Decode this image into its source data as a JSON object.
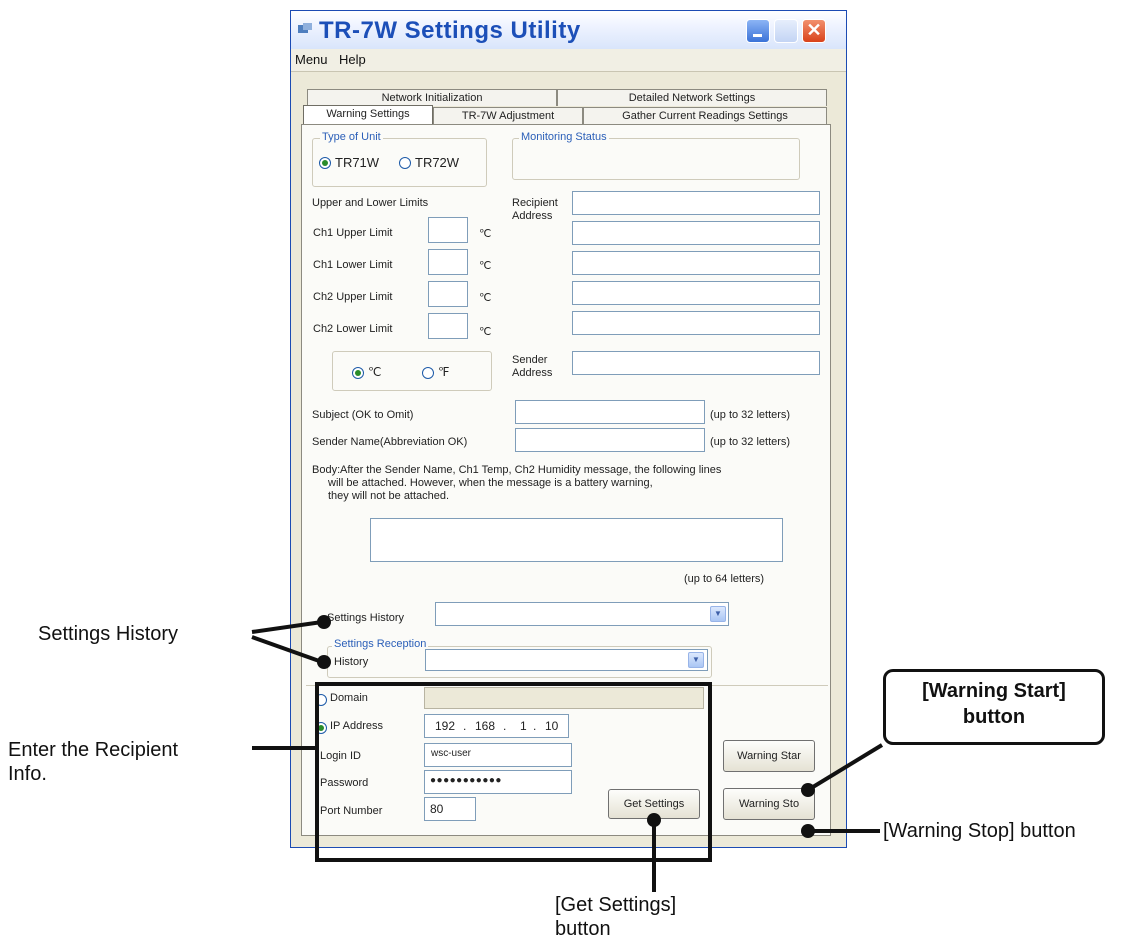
{
  "window": {
    "title": "TR-7W Settings Utility",
    "menu": [
      "Menu",
      "Help"
    ],
    "close_glyph": "✕"
  },
  "tabs": {
    "row1": [
      "Network Initialization",
      "Detailed Network Settings"
    ],
    "row2": [
      "Warning Settings",
      "TR-7W Adjustment",
      "Gather Current Readings Settings"
    ]
  },
  "unit_type": {
    "legend": "Type of Unit",
    "options": [
      "TR71W",
      "TR72W"
    ],
    "selected": "TR71W"
  },
  "monitoring_status": {
    "legend": "Monitoring Status"
  },
  "limits": {
    "heading": "Upper and Lower Limits",
    "rows": [
      {
        "label": "Ch1 Upper Limit",
        "unit": "℃"
      },
      {
        "label": "Ch1 Lower Limit",
        "unit": "℃"
      },
      {
        "label": "Ch2 Upper Limit",
        "unit": "℃"
      },
      {
        "label": "Ch2 Lower Limit",
        "unit": "℃"
      }
    ],
    "temp_units": [
      "℃",
      "℉"
    ],
    "temp_unit_selected": "℃"
  },
  "recipient": {
    "label_line1": "Recipient",
    "label_line2": "Address"
  },
  "sender": {
    "label_line1": "Sender",
    "label_line2": "Address"
  },
  "subject": {
    "label": "Subject (OK to Omit)",
    "hint": "(up to 32 letters)"
  },
  "sender_name": {
    "label": "Sender Name(Abbreviation OK)",
    "hint": "(up to 32 letters)"
  },
  "body": {
    "label": "Body:",
    "text_line1": "After the Sender Name, Ch1 Temp, Ch2 Humidity message, the following lines",
    "text_line2": "will be attached. However, when the message is a battery warning,",
    "text_line3": "they will not be attached.",
    "hint": "(up to 64 letters)"
  },
  "settings_history": {
    "label": "Settings History"
  },
  "settings_reception": {
    "legend": "Settings Reception",
    "history_label": "History"
  },
  "connection": {
    "domain_label": "Domain",
    "ip_label": "IP Address",
    "ip_octets": [
      "192",
      "168",
      "1",
      "10"
    ],
    "login_label": "Login ID",
    "login_value": "wsc-user",
    "password_label": "Password",
    "password_value": "●●●●●●●●●●●",
    "port_label": "Port Number",
    "port_value": "80",
    "selected": "IP Address"
  },
  "buttons": {
    "get_settings": "Get Settings",
    "warning_start": "Warning Star",
    "warning_stop": "Warning Sto"
  },
  "callouts": {
    "settings_history": "Settings History",
    "enter_recipient_line1": "Enter the Recipient",
    "enter_recipient_line2": "Info.",
    "warning_start_line1": "[Warning Start]",
    "warning_start_line2": "button",
    "warning_stop": "[Warning Stop] button",
    "get_settings_line1": "[Get Settings]",
    "get_settings_line2": "button"
  }
}
